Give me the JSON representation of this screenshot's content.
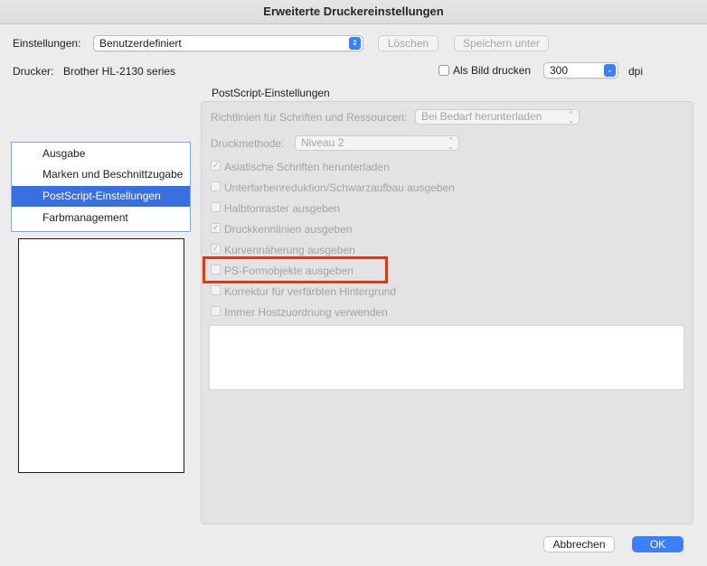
{
  "window": {
    "title": "Erweiterte Druckereinstellungen"
  },
  "settings": {
    "label": "Einstellungen:",
    "value": "Benutzerdefiniert",
    "delete_button": "Löschen",
    "save_as_button": "Speichern unter"
  },
  "printer": {
    "label": "Drucker:",
    "value": "Brother HL-2130 series",
    "print_as_image_label": "Als Bild drucken",
    "print_as_image_checked": false,
    "dpi_value": "300",
    "dpi_unit": "dpi"
  },
  "sidebar": {
    "items": [
      {
        "label": "Ausgabe",
        "selected": false
      },
      {
        "label": "Marken und Beschnittzugabe",
        "selected": false
      },
      {
        "label": "PostScript-Einstellungen",
        "selected": true
      },
      {
        "label": "Farbmanagement",
        "selected": false
      }
    ]
  },
  "section": {
    "title": "PostScript-Einstellungen",
    "font_policy_label": "Richtlinien für Schriften und Ressourcen:",
    "font_policy_value": "Bei Bedarf herunterladen",
    "print_method_label": "Druckmethode:",
    "print_method_value": "Niveau 2",
    "options": [
      {
        "label": "Asiatische Schriften herunterladen",
        "checked": true
      },
      {
        "label": "Unterfarbenreduktion/Schwarzaufbau ausgeben",
        "checked": false
      },
      {
        "label": "Halbtonraster ausgeben",
        "checked": false
      },
      {
        "label": "Druckkennlinien ausgeben",
        "checked": true
      },
      {
        "label": "Kurvennäherung ausgeben",
        "checked": true
      },
      {
        "label": "PS-Formobjekte ausgeben",
        "checked": false
      },
      {
        "label": "Korrektur für verfärbten Hintergrund",
        "checked": false
      },
      {
        "label": "Immer Hostzuordnung verwenden",
        "checked": false
      }
    ]
  },
  "footer": {
    "cancel_button": "Abbrechen",
    "ok_button": "OK"
  },
  "colors": {
    "accent": "#3a6fe0",
    "highlight_border": "#d83a1c"
  }
}
